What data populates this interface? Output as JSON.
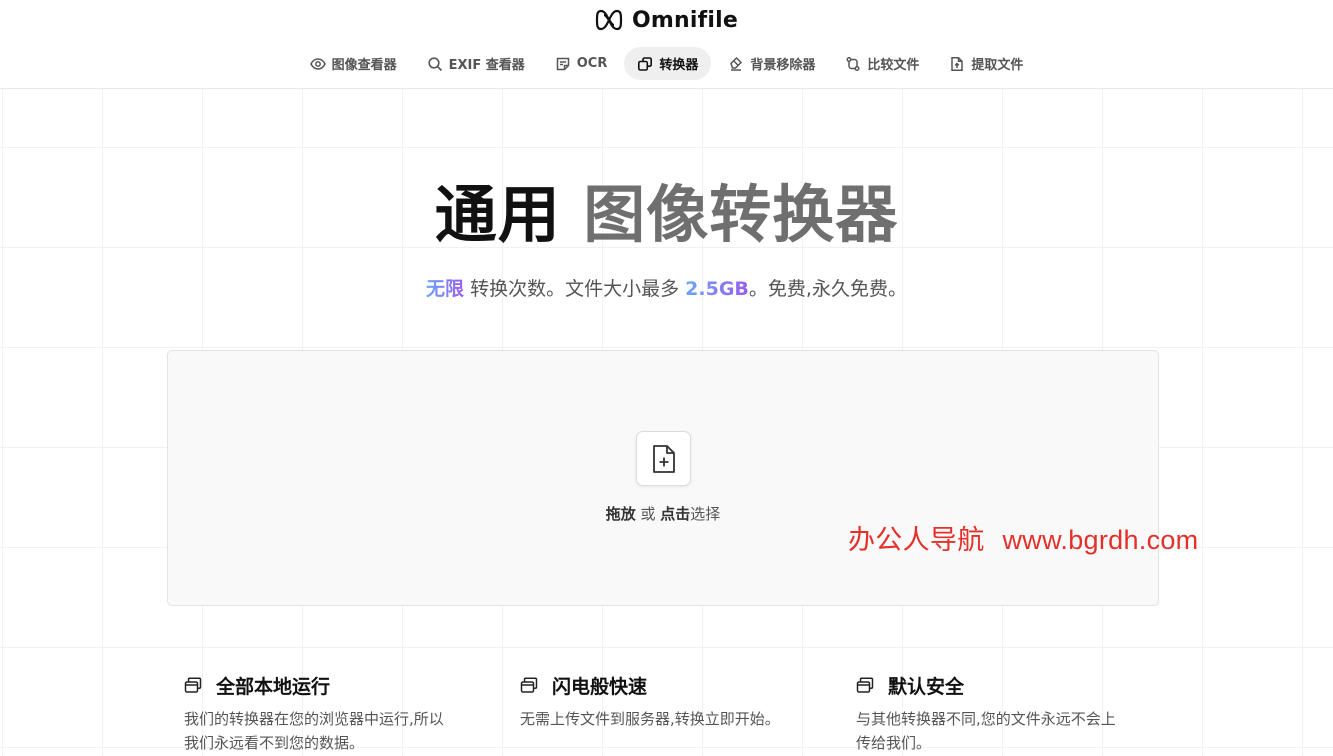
{
  "brand": {
    "name": "Omnifile",
    "logo_icon": "infinity-knot-icon"
  },
  "nav": {
    "items": [
      {
        "label": "图像查看器",
        "icon": "eye-icon",
        "active": false
      },
      {
        "label": "EXIF 查看器",
        "icon": "search-icon",
        "active": false
      },
      {
        "label": "OCR",
        "icon": "note-icon",
        "active": false
      },
      {
        "label": "转换器",
        "icon": "convert-icon",
        "active": true
      },
      {
        "label": "背景移除器",
        "icon": "eraser-icon",
        "active": false
      },
      {
        "label": "比较文件",
        "icon": "git-compare-icon",
        "active": false
      },
      {
        "label": "提取文件",
        "icon": "file-extract-icon",
        "active": false
      }
    ]
  },
  "hero": {
    "title_part1": "通用",
    "title_part2": "图像转换器",
    "subtitle": {
      "highlight1": "无限",
      "text1": " 转换次数。文件大小最多 ",
      "highlight2": "2.5GB",
      "text2": "。免费,永久免费。"
    }
  },
  "dropzone": {
    "icon": "file-plus-icon",
    "strong1": "拖放",
    "middle": " 或 ",
    "strong2": "点击",
    "tail": "选择"
  },
  "watermark": {
    "text": "办公人导航",
    "url": "www.bgrdh.com"
  },
  "features": [
    {
      "icon": "windows-icon",
      "title": "全部本地运行",
      "line1": "我们的转换器在您的浏览器中运行,所以",
      "line2": "我们永远看不到您的数据。"
    },
    {
      "icon": "windows-icon",
      "title": "闪电般快速",
      "line1": "无需上传文件到服务器,转换立即开始。",
      "line2": ""
    },
    {
      "icon": "windows-icon",
      "title": "默认安全",
      "line1": "与其他转换器不同,您的文件永远不会上",
      "line2": "传给我们。"
    }
  ],
  "colors": {
    "accent_start": "#6aa7f5",
    "accent_end": "#9b5cf0",
    "watermark": "#e5302a"
  }
}
